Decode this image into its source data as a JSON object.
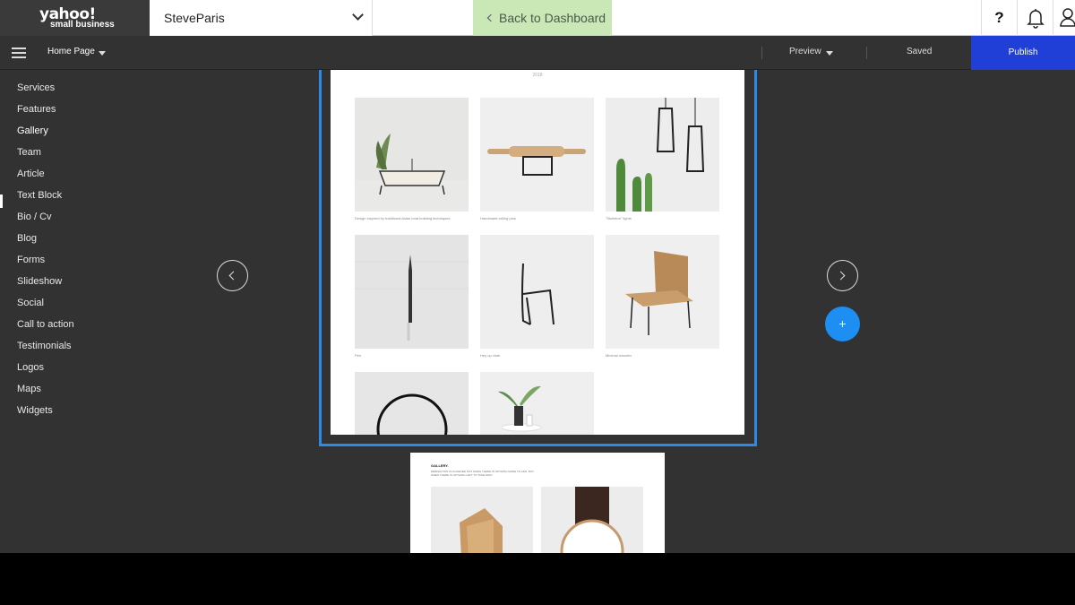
{
  "topbar": {
    "logo_main": "yahoo!",
    "logo_sub": "small business",
    "site_name": "SteveParis",
    "back_label": "Back to Dashboard",
    "help_label": "?"
  },
  "subbar": {
    "page_select": "Home Page",
    "preview_label": "Preview",
    "saved_label": "Saved",
    "publish_label": "Publish"
  },
  "sidebar": {
    "items": [
      "Services",
      "Features",
      "Gallery",
      "Team",
      "Article",
      "Text Block",
      "Bio / Cv",
      "Blog",
      "Forms",
      "Slideshow",
      "Social",
      "Call to action",
      "Testimonials",
      "Logos",
      "Maps",
      "Widgets"
    ],
    "active": "Gallery"
  },
  "gallery": {
    "header_line": "2018",
    "captions": [
      "Design inspired by traditional Asian boat building techniques",
      "Handmade rolling pins",
      "\"Skeleton\" lights",
      "Pen",
      "Hey up chair",
      "Minimal wooden"
    ]
  },
  "next_section": {
    "title": "GALLERY.",
    "subtitle": "PERFECTION IS ACHIEVED NOT WHEN THERE IS NOTHING MORE TO ADD, BUT WHEN THERE IS NOTHING LEFT TO TAKE AWAY."
  },
  "add_label": "+"
}
